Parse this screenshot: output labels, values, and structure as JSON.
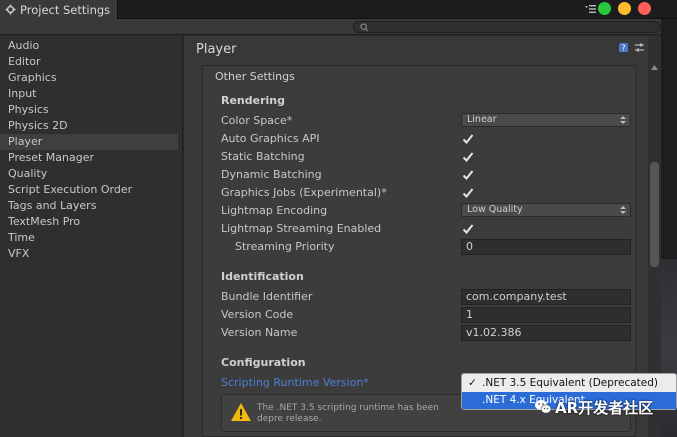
{
  "window": {
    "tab_title": "Project Settings"
  },
  "sidebar": {
    "items": [
      {
        "label": "Audio"
      },
      {
        "label": "Editor"
      },
      {
        "label": "Graphics"
      },
      {
        "label": "Input"
      },
      {
        "label": "Physics"
      },
      {
        "label": "Physics 2D"
      },
      {
        "label": "Player",
        "selected": true
      },
      {
        "label": "Preset Manager"
      },
      {
        "label": "Quality"
      },
      {
        "label": "Script Execution Order"
      },
      {
        "label": "Tags and Layers"
      },
      {
        "label": "TextMesh Pro"
      },
      {
        "label": "Time"
      },
      {
        "label": "VFX"
      }
    ]
  },
  "main": {
    "header": "Player",
    "section": "Other Settings",
    "rendering": {
      "title": "Rendering",
      "color_space": {
        "label": "Color Space*",
        "value": "Linear"
      },
      "auto_graphics_api": {
        "label": "Auto Graphics API",
        "checked": true
      },
      "static_batching": {
        "label": "Static Batching",
        "checked": true
      },
      "dynamic_batching": {
        "label": "Dynamic Batching",
        "checked": true
      },
      "graphics_jobs": {
        "label": "Graphics Jobs (Experimental)*",
        "checked": true
      },
      "lightmap_encoding": {
        "label": "Lightmap Encoding",
        "value": "Low Quality"
      },
      "lightmap_streaming": {
        "label": "Lightmap Streaming Enabled",
        "checked": true
      },
      "streaming_priority": {
        "label": "Streaming Priority",
        "value": "0"
      }
    },
    "identification": {
      "title": "Identification",
      "bundle_identifier": {
        "label": "Bundle Identifier",
        "value": "com.company.test"
      },
      "version_code": {
        "label": "Version Code",
        "value": "1"
      },
      "version_name": {
        "label": "Version Name",
        "value": "v1.02.386"
      }
    },
    "configuration": {
      "title": "Configuration",
      "scripting_runtime": {
        "label": "Scripting Runtime Version*"
      }
    },
    "warning": {
      "text": "The .NET 3.5 scripting runtime has been depre release."
    }
  },
  "popup": {
    "options": [
      {
        "label": ".NET 3.5 Equivalent (Deprecated)",
        "checked": true
      },
      {
        "label": ".NET 4.x Equivalent",
        "highlighted": true
      }
    ],
    "check_mark": "✓"
  },
  "watermark": {
    "text": "AR开发者社区"
  },
  "colors": {
    "selection_blue": "#2c6cd9",
    "link_blue": "#4c7fd6",
    "traffic_green": "#27c840",
    "traffic_yellow": "#ffbd2e",
    "traffic_red": "#fe5f57"
  }
}
